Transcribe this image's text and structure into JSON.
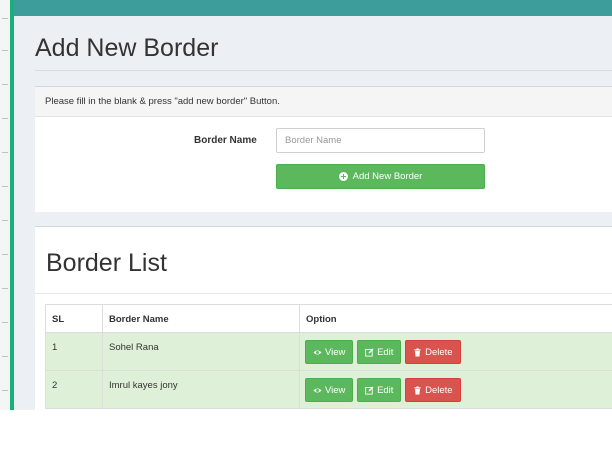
{
  "page": {
    "title": "Add New Border"
  },
  "form": {
    "instruction": "Please fill in the blank & press \"add new border\" Button.",
    "border_name_label": "Border Name",
    "border_name_placeholder": "Border Name",
    "border_name_value": "",
    "submit_label": "Add New Border"
  },
  "list": {
    "title": "Border List",
    "columns": [
      "SL",
      "Border Name",
      "Option"
    ],
    "rows": [
      {
        "sl": "1",
        "name": "Sohel Rana"
      },
      {
        "sl": "2",
        "name": "Imrul kayes jony"
      }
    ],
    "actions": {
      "view_label": "View",
      "edit_label": "Edit",
      "delete_label": "Delete"
    }
  },
  "icons": {
    "add": "plus-circle-icon",
    "view": "eye-icon",
    "edit": "edit-icon",
    "delete": "trash-icon"
  },
  "colors": {
    "accent_green": "#18b07a",
    "header_teal": "#3c9d9a",
    "success": "#5cb85c",
    "danger": "#d9534f",
    "row_highlight": "#dff0d8"
  }
}
